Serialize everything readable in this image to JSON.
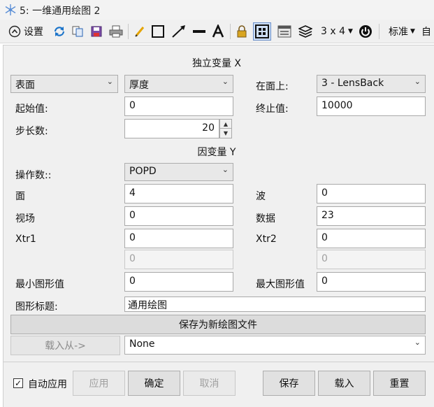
{
  "window": {
    "title": "5: 一维通用绘图 2"
  },
  "toolbar": {
    "settings_label": "设置",
    "grid_label": "3 x 4",
    "standard_label": "标准",
    "auto_label": "自"
  },
  "independent": {
    "header": "独立变量 X",
    "type_value": "表面",
    "param_value": "厚度",
    "on_surface_label": "在面上:",
    "on_surface_value": "3 - LensBack",
    "start_label": "起始值:",
    "start_value": "0",
    "stop_label": "终止值:",
    "stop_value": "10000",
    "steps_label": "步长数:",
    "steps_value": "20"
  },
  "dependent": {
    "header": "因变量 Y",
    "operand_label": "操作数::",
    "operand_value": "POPD",
    "surf_label": "面",
    "surf_value": "4",
    "wave_label": "波",
    "wave_value": "0",
    "field_label": "视场",
    "field_value": "0",
    "data_label": "数据",
    "data_value": "23",
    "xtr1_label": "Xtr1",
    "xtr1_value": "0",
    "xtr2_label": "Xtr2",
    "xtr2_value": "0",
    "extra1_value": "0",
    "extra2_value": "0",
    "min_label": "最小图形值",
    "min_value": "0",
    "max_label": "最大图形值",
    "max_value": "0",
    "plot_title_label": "图形标题:",
    "plot_title_value": "通用绘图"
  },
  "file": {
    "save_new_label": "保存为新绘图文件",
    "load_from_label": "载入从->",
    "load_value": "None"
  },
  "bottom": {
    "auto_apply_label": "自动应用",
    "auto_apply_checked": "✓",
    "apply_label": "应用",
    "ok_label": "确定",
    "cancel_label": "取消",
    "save_label": "保存",
    "load_label": "载入",
    "reset_label": "重置"
  }
}
